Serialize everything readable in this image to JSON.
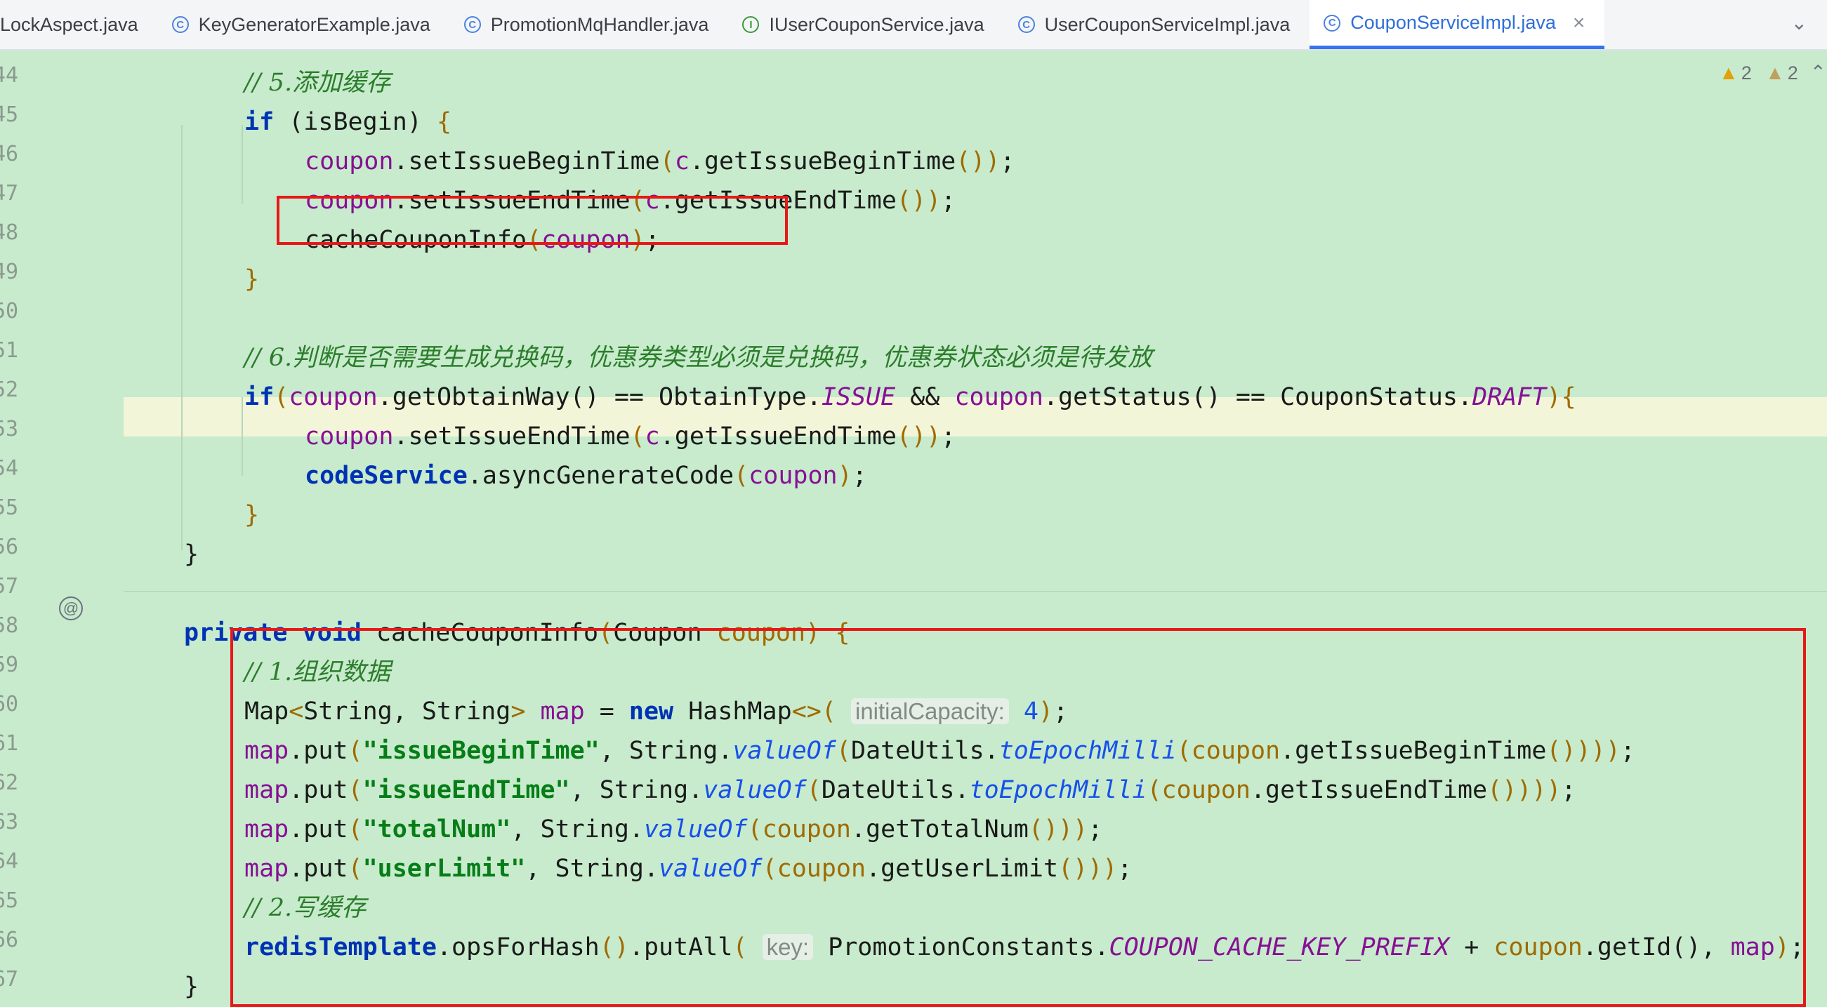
{
  "tabs": [
    {
      "label": "LockAspect.java",
      "icon": "none",
      "active": false
    },
    {
      "label": "KeyGeneratorExample.java",
      "icon": "class-icon",
      "active": false
    },
    {
      "label": "PromotionMqHandler.java",
      "icon": "class-icon",
      "active": false
    },
    {
      "label": "IUserCouponService.java",
      "icon": "interface-icon",
      "active": false
    },
    {
      "label": "UserCouponServiceImpl.java",
      "icon": "class-icon",
      "active": false
    },
    {
      "label": "CouponServiceImpl.java",
      "icon": "class-icon",
      "active": true
    }
  ],
  "inspections": {
    "warnings": "2",
    "weak_warnings": "2"
  },
  "line_numbers": [
    "44",
    "45",
    "46",
    "47",
    "48",
    "49",
    "50",
    "51",
    "52",
    "53",
    "54",
    "55",
    "56",
    "57",
    "58",
    "59",
    "60",
    "61",
    "62",
    "63",
    "64",
    "65",
    "66",
    "67"
  ],
  "code": {
    "c44": "// 5.添加缓存",
    "c51": "// 6.判断是否需要生成兑换码，优惠券类型必须是兑换码，优惠券状态必须是待发放",
    "c59": "// 1.组织数据",
    "c65": "// 2.写缓存",
    "hint_capacity": "initialCapacity:",
    "hint_key": "key:",
    "s_begin": "\"issueBeginTime\"",
    "s_end": "\"issueEndTime\"",
    "s_total": "\"totalNum\"",
    "s_limit": "\"userLimit\""
  },
  "colors": {
    "background": "#c7ebcc",
    "highlight_box": "#e81818",
    "active_tab": "#3574f0"
  }
}
